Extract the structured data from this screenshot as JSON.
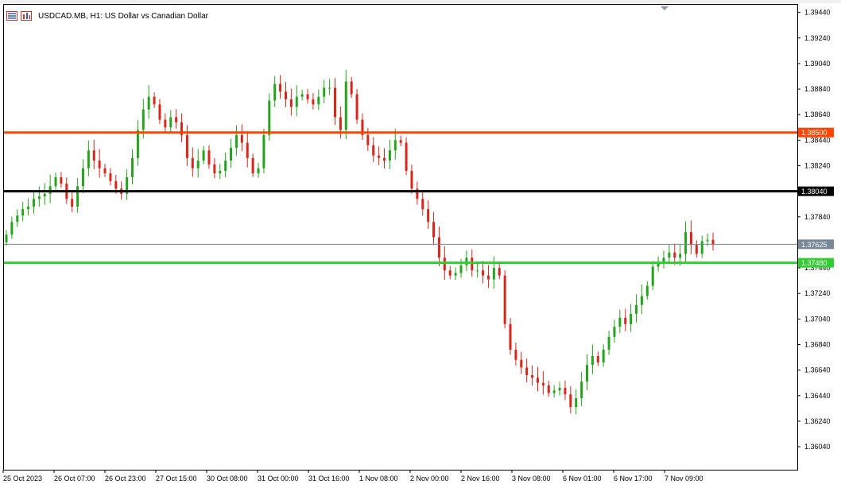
{
  "header": {
    "title": "USDCAD.MB, H1:  US Dollar vs Canadian Dollar"
  },
  "colors": {
    "bull": "#26a41e",
    "bear": "#d7261c",
    "line_black": "#000000",
    "line_red": "#ff4500",
    "line_green": "#32cd32",
    "price_line": "#778899"
  },
  "chart_data": {
    "type": "candlestick",
    "symbol": "USDCAD.MB",
    "timeframe": "H1",
    "title": "USDCAD.MB, H1:  US Dollar vs Canadian Dollar",
    "ylim": [
      1.3586,
      1.395
    ],
    "y_ticks": [
      "1.39440",
      "1.39240",
      "1.39040",
      "1.38840",
      "1.38640",
      "1.38440",
      "1.38240",
      "1.38040",
      "1.37840",
      "1.37640",
      "1.37440",
      "1.37240",
      "1.37040",
      "1.36840",
      "1.36640",
      "1.36440",
      "1.36240",
      "1.36040"
    ],
    "x_labels": [
      "25 Oct 2023",
      "26 Oct 07:00",
      "26 Oct 23:00",
      "27 Oct 15:00",
      "30 Oct 08:00",
      "31 Oct 00:00",
      "31 Oct 16:00",
      "1 Nov 08:00",
      "2 Nov 00:00",
      "2 Nov 16:00",
      "3 Nov 08:00",
      "6 Nov 01:00",
      "6 Nov 17:00",
      "7 Nov 09:00"
    ],
    "levels": [
      {
        "label": "1.38500",
        "value": 1.385,
        "color": "#ff4500"
      },
      {
        "label": "1.38040",
        "value": 1.3804,
        "color": "#000000"
      },
      {
        "label": "1.37480",
        "value": 1.3748,
        "color": "#32cd32"
      }
    ],
    "current_price": {
      "label": "1.37625",
      "value": 1.37625
    },
    "series": [
      {
        "name": "close",
        "values": [
          1.377,
          1.378,
          1.3785,
          1.379,
          1.3792,
          1.3798,
          1.38,
          1.3802,
          1.3808,
          1.3815,
          1.381,
          1.3798,
          1.3792,
          1.3808,
          1.3822,
          1.3836,
          1.3828,
          1.3822,
          1.3818,
          1.3812,
          1.3806,
          1.3802,
          1.3815,
          1.383,
          1.3852,
          1.3868,
          1.3878,
          1.3872,
          1.386,
          1.3854,
          1.3862,
          1.3858,
          1.3848,
          1.383,
          1.3822,
          1.3828,
          1.3836,
          1.3825,
          1.3818,
          1.382,
          1.3828,
          1.3838,
          1.3848,
          1.3842,
          1.383,
          1.3818,
          1.3822,
          1.3848,
          1.3875,
          1.3888,
          1.3882,
          1.3876,
          1.387,
          1.3878,
          1.388,
          1.3876,
          1.3872,
          1.3878,
          1.3885,
          1.3885,
          1.3862,
          1.3852,
          1.389,
          1.388,
          1.386,
          1.3848,
          1.384,
          1.3832,
          1.383,
          1.3828,
          1.3836,
          1.3844,
          1.3842,
          1.382,
          1.3806,
          1.3798,
          1.379,
          1.378,
          1.3768,
          1.3752,
          1.3742,
          1.3738,
          1.374,
          1.3746,
          1.3752,
          1.3742,
          1.3742,
          1.3738,
          1.3735,
          1.3744,
          1.3738,
          1.37,
          1.368,
          1.3672,
          1.3666,
          1.366,
          1.3658,
          1.3654,
          1.3652,
          1.3646,
          1.3648,
          1.365,
          1.3645,
          1.3635,
          1.3642,
          1.3655,
          1.3668,
          1.3675,
          1.367,
          1.368,
          1.369,
          1.3698,
          1.3705,
          1.37,
          1.3708,
          1.3715,
          1.3722,
          1.373,
          1.3745,
          1.3748,
          1.3752,
          1.3756,
          1.3752,
          1.3755,
          1.3772,
          1.3762,
          1.3755,
          1.3765,
          1.3766,
          1.3762
        ]
      }
    ]
  }
}
